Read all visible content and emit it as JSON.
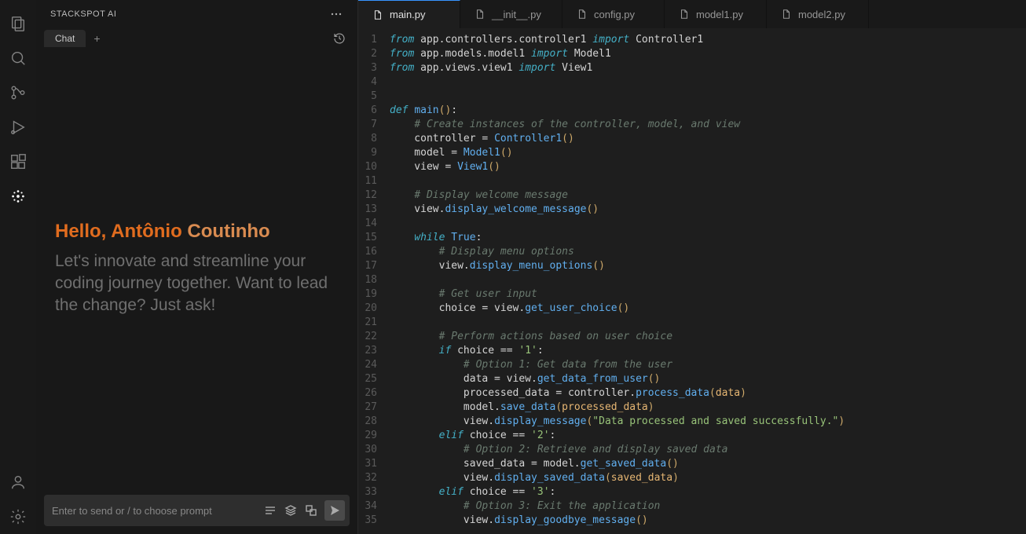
{
  "panel": {
    "title": "STACKSPOT AI",
    "tab": "Chat",
    "hello_prefix": "Hello, Antônio ",
    "hello_suffix": "Coutinho",
    "subtitle": "Let's innovate and streamline your coding journey together. Want to lead the change? Just ask!",
    "input_placeholder": "Enter to send or / to choose prompt"
  },
  "tabs": [
    {
      "label": "main.py",
      "active": true
    },
    {
      "label": "__init__.py",
      "active": false
    },
    {
      "label": "config.py",
      "active": false
    },
    {
      "label": "model1.py",
      "active": false
    },
    {
      "label": "model2.py",
      "active": false
    }
  ],
  "code_lines": [
    [
      {
        "t": "from ",
        "c": "tok-kw"
      },
      {
        "t": "app.controllers.controller1 ",
        "c": ""
      },
      {
        "t": "import ",
        "c": "tok-kw"
      },
      {
        "t": "Controller1",
        "c": ""
      }
    ],
    [
      {
        "t": "from ",
        "c": "tok-kw"
      },
      {
        "t": "app.models.model1 ",
        "c": ""
      },
      {
        "t": "import ",
        "c": "tok-kw"
      },
      {
        "t": "Model1",
        "c": ""
      }
    ],
    [
      {
        "t": "from ",
        "c": "tok-kw"
      },
      {
        "t": "app.views.view1 ",
        "c": ""
      },
      {
        "t": "import ",
        "c": "tok-kw"
      },
      {
        "t": "View1",
        "c": ""
      }
    ],
    [],
    [],
    [
      {
        "t": "def ",
        "c": "tok-kw2"
      },
      {
        "t": "main",
        "c": "tok-fn"
      },
      {
        "t": "()",
        "c": "tok-par"
      },
      {
        "t": ":",
        "c": ""
      }
    ],
    [
      {
        "t": "    ",
        "c": ""
      },
      {
        "t": "# Create instances of the controller, model, and view",
        "c": "tok-com"
      }
    ],
    [
      {
        "t": "    controller = ",
        "c": ""
      },
      {
        "t": "Controller1",
        "c": "tok-type"
      },
      {
        "t": "()",
        "c": "tok-par"
      }
    ],
    [
      {
        "t": "    model = ",
        "c": ""
      },
      {
        "t": "Model1",
        "c": "tok-type"
      },
      {
        "t": "()",
        "c": "tok-par"
      }
    ],
    [
      {
        "t": "    view = ",
        "c": ""
      },
      {
        "t": "View1",
        "c": "tok-type"
      },
      {
        "t": "()",
        "c": "tok-par"
      }
    ],
    [],
    [
      {
        "t": "    ",
        "c": ""
      },
      {
        "t": "# Display welcome message",
        "c": "tok-com"
      }
    ],
    [
      {
        "t": "    view.",
        "c": ""
      },
      {
        "t": "display_welcome_message",
        "c": "tok-call"
      },
      {
        "t": "()",
        "c": "tok-par"
      }
    ],
    [],
    [
      {
        "t": "    ",
        "c": ""
      },
      {
        "t": "while ",
        "c": "tok-kw2"
      },
      {
        "t": "True",
        "c": "tok-type"
      },
      {
        "t": ":",
        "c": ""
      }
    ],
    [
      {
        "t": "        ",
        "c": ""
      },
      {
        "t": "# Display menu options",
        "c": "tok-com"
      }
    ],
    [
      {
        "t": "        view.",
        "c": ""
      },
      {
        "t": "display_menu_options",
        "c": "tok-call"
      },
      {
        "t": "()",
        "c": "tok-par"
      }
    ],
    [],
    [
      {
        "t": "        ",
        "c": ""
      },
      {
        "t": "# Get user input",
        "c": "tok-com"
      }
    ],
    [
      {
        "t": "        choice = view.",
        "c": ""
      },
      {
        "t": "get_user_choice",
        "c": "tok-call"
      },
      {
        "t": "()",
        "c": "tok-par"
      }
    ],
    [],
    [
      {
        "t": "        ",
        "c": ""
      },
      {
        "t": "# Perform actions based on user choice",
        "c": "tok-com"
      }
    ],
    [
      {
        "t": "        ",
        "c": ""
      },
      {
        "t": "if ",
        "c": "tok-kw2"
      },
      {
        "t": "choice == ",
        "c": ""
      },
      {
        "t": "'1'",
        "c": "tok-str"
      },
      {
        "t": ":",
        "c": ""
      }
    ],
    [
      {
        "t": "            ",
        "c": ""
      },
      {
        "t": "# Option 1: Get data from the user",
        "c": "tok-com"
      }
    ],
    [
      {
        "t": "            data = view.",
        "c": ""
      },
      {
        "t": "get_data_from_user",
        "c": "tok-call"
      },
      {
        "t": "()",
        "c": "tok-par"
      }
    ],
    [
      {
        "t": "            processed_data = controller.",
        "c": ""
      },
      {
        "t": "process_data",
        "c": "tok-call"
      },
      {
        "t": "(",
        "c": "tok-par"
      },
      {
        "t": "data",
        "c": "tok-var"
      },
      {
        "t": ")",
        "c": "tok-par"
      }
    ],
    [
      {
        "t": "            model.",
        "c": ""
      },
      {
        "t": "save_data",
        "c": "tok-call"
      },
      {
        "t": "(",
        "c": "tok-par"
      },
      {
        "t": "processed_data",
        "c": "tok-var"
      },
      {
        "t": ")",
        "c": "tok-par"
      }
    ],
    [
      {
        "t": "            view.",
        "c": ""
      },
      {
        "t": "display_message",
        "c": "tok-call"
      },
      {
        "t": "(",
        "c": "tok-par"
      },
      {
        "t": "\"Data processed and saved successfully.\"",
        "c": "tok-str"
      },
      {
        "t": ")",
        "c": "tok-par"
      }
    ],
    [
      {
        "t": "        ",
        "c": ""
      },
      {
        "t": "elif ",
        "c": "tok-kw2"
      },
      {
        "t": "choice == ",
        "c": ""
      },
      {
        "t": "'2'",
        "c": "tok-str"
      },
      {
        "t": ":",
        "c": ""
      }
    ],
    [
      {
        "t": "            ",
        "c": ""
      },
      {
        "t": "# Option 2: Retrieve and display saved data",
        "c": "tok-com"
      }
    ],
    [
      {
        "t": "            saved_data = model.",
        "c": ""
      },
      {
        "t": "get_saved_data",
        "c": "tok-call"
      },
      {
        "t": "()",
        "c": "tok-par"
      }
    ],
    [
      {
        "t": "            view.",
        "c": ""
      },
      {
        "t": "display_saved_data",
        "c": "tok-call"
      },
      {
        "t": "(",
        "c": "tok-par"
      },
      {
        "t": "saved_data",
        "c": "tok-var"
      },
      {
        "t": ")",
        "c": "tok-par"
      }
    ],
    [
      {
        "t": "        ",
        "c": ""
      },
      {
        "t": "elif ",
        "c": "tok-kw2"
      },
      {
        "t": "choice == ",
        "c": ""
      },
      {
        "t": "'3'",
        "c": "tok-str"
      },
      {
        "t": ":",
        "c": ""
      }
    ],
    [
      {
        "t": "            ",
        "c": ""
      },
      {
        "t": "# Option 3: Exit the application",
        "c": "tok-com"
      }
    ],
    [
      {
        "t": "            view.",
        "c": ""
      },
      {
        "t": "display_goodbye_message",
        "c": "tok-call"
      },
      {
        "t": "()",
        "c": "tok-par"
      }
    ]
  ]
}
